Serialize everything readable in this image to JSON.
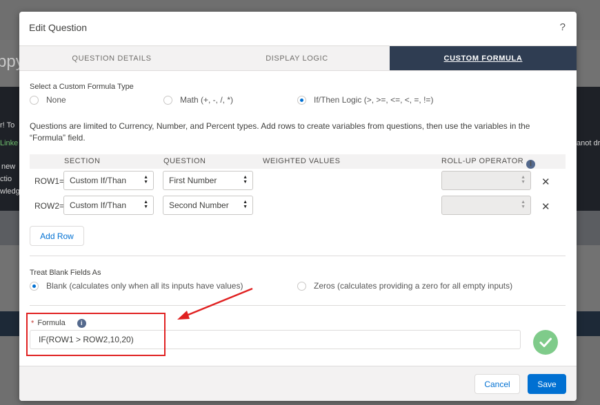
{
  "background": {
    "fragments": [
      "r! To",
      "Linke",
      "new",
      "ctio",
      "wledg",
      "anot dr"
    ],
    "big_text": "ppy"
  },
  "modal": {
    "title": "Edit Question",
    "help": "?"
  },
  "tabs": [
    {
      "label": "QUESTION DETAILS",
      "active": false
    },
    {
      "label": "DISPLAY LOGIC",
      "active": false
    },
    {
      "label": "CUSTOM FORMULA",
      "active": true
    }
  ],
  "formula_type": {
    "label": "Select a Custom Formula Type",
    "options": [
      {
        "label": "None",
        "selected": false
      },
      {
        "label": "Math (+, -, /, *)",
        "selected": false
      },
      {
        "label": "If/Then Logic (>, >=, <=, <, =, !=)",
        "selected": true
      }
    ]
  },
  "note": "Questions are limited to Currency, Number, and Percent types. Add rows to create variables from questions, then use the variables in the “Formula” field.",
  "grid": {
    "headers": {
      "section": "SECTION",
      "question": "QUESTION",
      "weighted": "WEIGHTED VALUES",
      "rollup": "ROLL-UP OPERATOR"
    },
    "rows": [
      {
        "label": "ROW1=",
        "section": "Custom If/Than",
        "question": "First Number"
      },
      {
        "label": "ROW2=",
        "section": "Custom If/Than",
        "question": "Second Number"
      }
    ],
    "remove_glyph": "✕"
  },
  "add_row_label": "Add Row",
  "blank_fields": {
    "label": "Treat Blank Fields As",
    "options": [
      {
        "label": "Blank (calculates only when all its inputs have values)",
        "selected": true
      },
      {
        "label": "Zeros (calculates providing a zero for all empty inputs)",
        "selected": false
      }
    ]
  },
  "formula": {
    "required_mark": "*",
    "label": "Formula",
    "value": "IF(ROW1 > ROW2,10,20)"
  },
  "footer": {
    "cancel": "Cancel",
    "save": "Save"
  },
  "colors": {
    "accent": "#0070d2",
    "active_tab": "#2f3d52",
    "annotation": "#e02020",
    "valid": "#7fcb8a"
  }
}
